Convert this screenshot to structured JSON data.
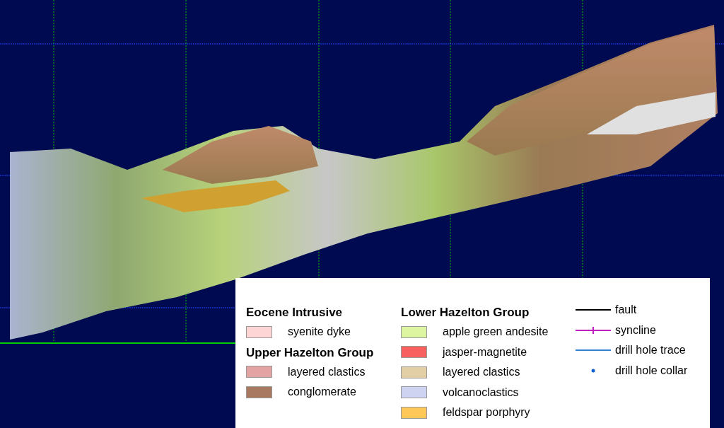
{
  "legend": {
    "columns": [
      {
        "groups": [
          {
            "title": "Eocene Intrusive",
            "items": [
              {
                "label": "syenite dyke",
                "color": "#fdd5d5"
              }
            ]
          },
          {
            "title": "Upper Hazelton Group",
            "items": [
              {
                "label": "layered clastics",
                "color": "#e4a3a3"
              },
              {
                "label": "conglomerate",
                "color": "#a87860"
              }
            ]
          }
        ]
      },
      {
        "groups": [
          {
            "title": "Lower Hazelton Group",
            "items": [
              {
                "label": "apple green andesite",
                "color": "#ddf5a0"
              },
              {
                "label": "jasper-magnetite",
                "color": "#f86060"
              },
              {
                "label": "layered clastics",
                "color": "#e2cfa5"
              },
              {
                "label": "volcanoclastics",
                "color": "#cdd3f0"
              },
              {
                "label": "feldspar porphyry",
                "color": "#fdc858"
              }
            ]
          }
        ]
      }
    ],
    "line_symbols": [
      {
        "kind": "line",
        "label": "fault",
        "color": "#000000"
      },
      {
        "kind": "tick-line",
        "label": "syncline",
        "color": "#c020c0"
      },
      {
        "kind": "line",
        "label": "drill hole trace",
        "color": "#3080d0"
      },
      {
        "kind": "dot",
        "label": "drill hole collar",
        "color": "#1060d0"
      }
    ]
  }
}
